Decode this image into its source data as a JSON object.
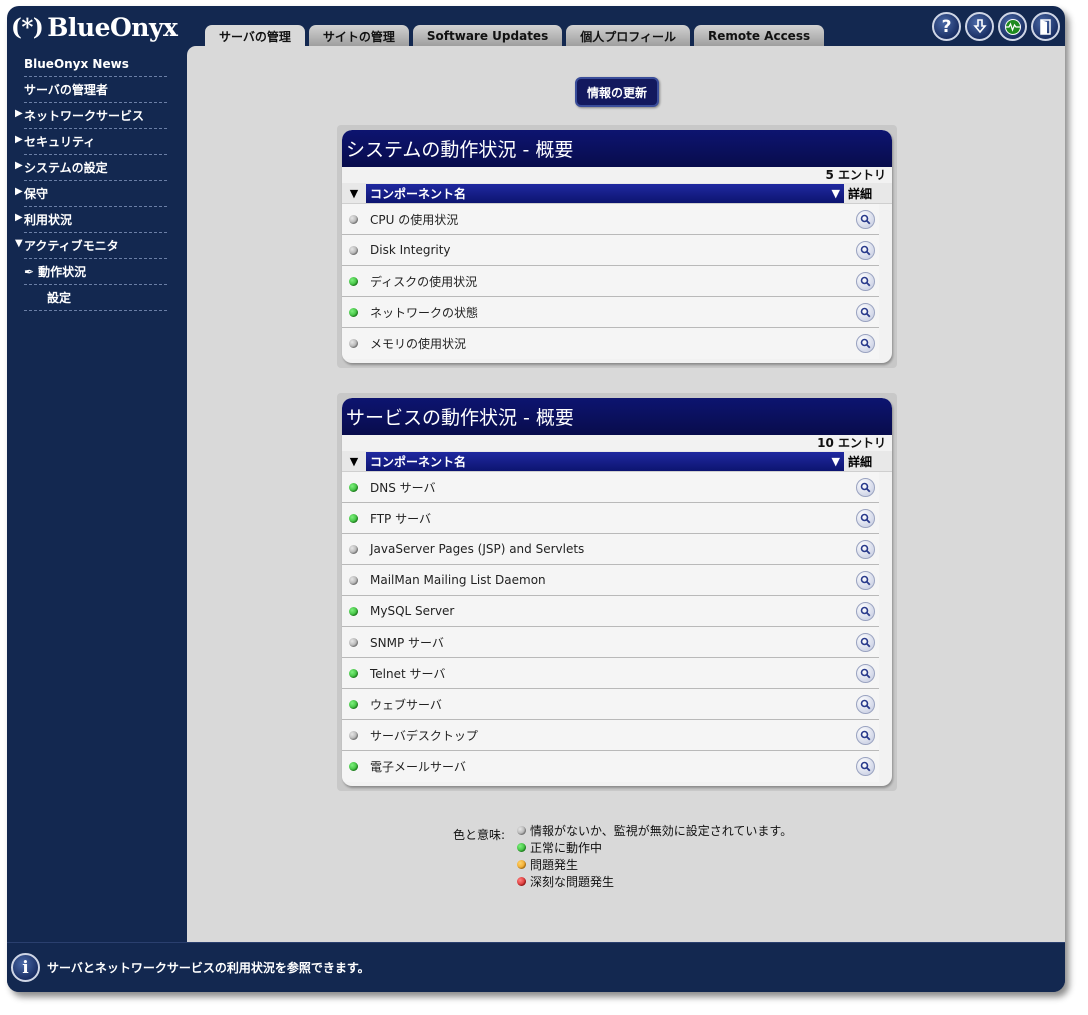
{
  "app": {
    "logo_mark": "(*)",
    "logo_text": "BlueOnyx"
  },
  "tabs": [
    {
      "label": "サーバの管理",
      "active": true
    },
    {
      "label": "サイトの管理",
      "active": false
    },
    {
      "label": "Software Updates",
      "active": false
    },
    {
      "label": "個人プロフィール",
      "active": false
    },
    {
      "label": "Remote Access",
      "active": false
    }
  ],
  "top_icons": [
    "help-icon",
    "download-icon",
    "monitor-icon",
    "logout-icon"
  ],
  "top_icon_glyphs": {
    "help": "?"
  },
  "sidebar": {
    "items": [
      {
        "label": "BlueOnyx News",
        "expand": "none",
        "indent": 0
      },
      {
        "label": "サーバの管理者",
        "expand": "none",
        "indent": 0
      },
      {
        "label": "ネットワークサービス",
        "expand": "collapsed",
        "indent": 0
      },
      {
        "label": "セキュリティ",
        "expand": "collapsed",
        "indent": 0
      },
      {
        "label": "システムの設定",
        "expand": "collapsed",
        "indent": 0
      },
      {
        "label": "保守",
        "expand": "collapsed",
        "indent": 0
      },
      {
        "label": "利用状況",
        "expand": "collapsed",
        "indent": 0
      },
      {
        "label": "アクティブモニタ",
        "expand": "expanded",
        "indent": 0
      },
      {
        "label": "動作状況",
        "expand": "none",
        "indent": 1,
        "selected": true
      },
      {
        "label": "設定",
        "expand": "none",
        "indent": 1
      }
    ],
    "arrow_collapsed": "▶",
    "arrow_expanded": "▼",
    "selected_mark": "✒"
  },
  "refresh_button": "情報の更新",
  "panels": [
    {
      "title": "システムの動作状況 - 概要",
      "count": "5 エントリ",
      "col_header": "コンポーネント名",
      "detail_header": "詳細",
      "rows": [
        {
          "name": "CPU の使用状況",
          "status": "gray"
        },
        {
          "name": "Disk Integrity",
          "status": "gray"
        },
        {
          "name": "ディスクの使用状況",
          "status": "green"
        },
        {
          "name": "ネットワークの状態",
          "status": "green"
        },
        {
          "name": "メモリの使用状況",
          "status": "gray"
        }
      ]
    },
    {
      "title": "サービスの動作状況 - 概要",
      "count": "10 エントリ",
      "col_header": "コンポーネント名",
      "detail_header": "詳細",
      "rows": [
        {
          "name": "DNS サーバ",
          "status": "green"
        },
        {
          "name": "FTP サーバ",
          "status": "green"
        },
        {
          "name": "JavaServer Pages (JSP) and Servlets",
          "status": "gray"
        },
        {
          "name": "MailMan Mailing List Daemon",
          "status": "gray"
        },
        {
          "name": "MySQL Server",
          "status": "green"
        },
        {
          "name": "SNMP サーバ",
          "status": "gray"
        },
        {
          "name": "Telnet サーバ",
          "status": "green"
        },
        {
          "name": "ウェブサーバ",
          "status": "green"
        },
        {
          "name": "サーバデスクトップ",
          "status": "gray"
        },
        {
          "name": "電子メールサーバ",
          "status": "green"
        }
      ]
    }
  ],
  "legend": {
    "label": "色と意味:",
    "items": [
      {
        "status": "gray",
        "text": "情報がないか、監視が無効に設定されています。"
      },
      {
        "status": "green",
        "text": "正常に動作中"
      },
      {
        "status": "orange",
        "text": "問題発生"
      },
      {
        "status": "red",
        "text": "深刻な問題発生"
      }
    ]
  },
  "statusbar": {
    "icon": "i",
    "text": "サーバとネットワークサービスの利用状況を参照できます。"
  },
  "colors": {
    "frame": "#132850",
    "panel_header": "#0d1470",
    "status_gray": "#8c8c8c",
    "status_green": "#0f9a0f",
    "status_orange": "#e68a00",
    "status_red": "#c00000"
  }
}
